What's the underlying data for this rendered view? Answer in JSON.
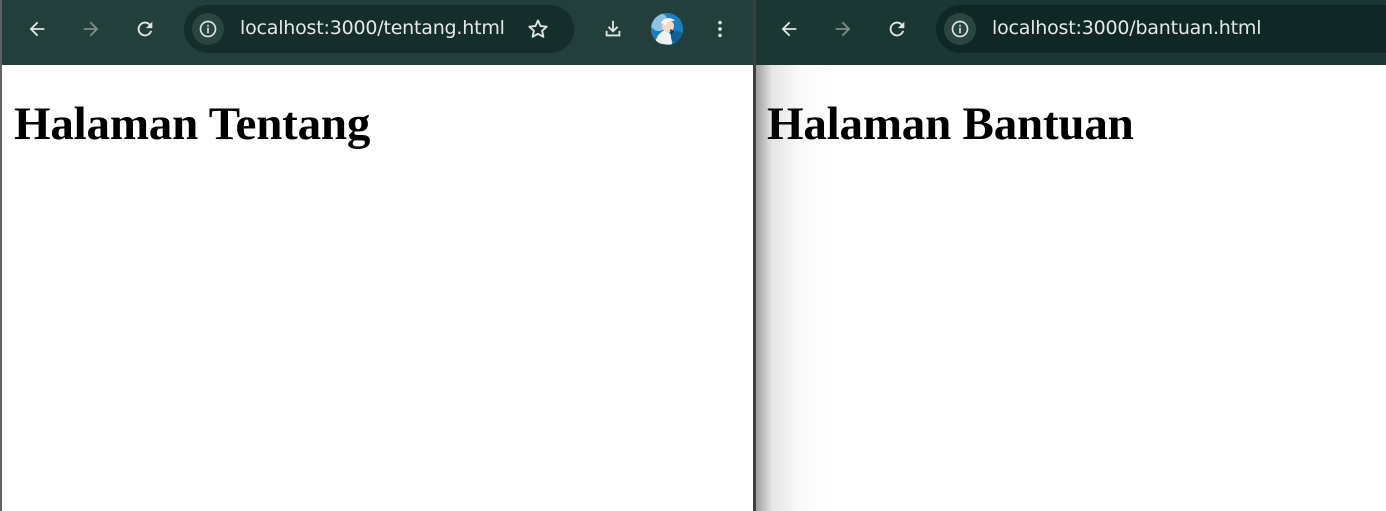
{
  "left_window": {
    "url": "localhost:3000/tentang.html",
    "heading": "Halaman Tentang"
  },
  "right_window": {
    "url": "localhost:3000/bantuan.html",
    "heading": "Halaman Bantuan"
  },
  "icons": {
    "back": "arrow-left",
    "forward": "arrow-right",
    "reload": "refresh",
    "site_info": "info-circle",
    "bookmark": "star-outline",
    "download": "download-arrow",
    "profile": "avatar",
    "menu": "kebab-vertical"
  },
  "colors": {
    "toolbar": "#233f3c",
    "omnibox": "#152e2b",
    "icon_active": "#dfe5e4",
    "icon_disabled": "#7d8c8a",
    "page_background": "#ffffff",
    "heading_text": "#000000"
  }
}
